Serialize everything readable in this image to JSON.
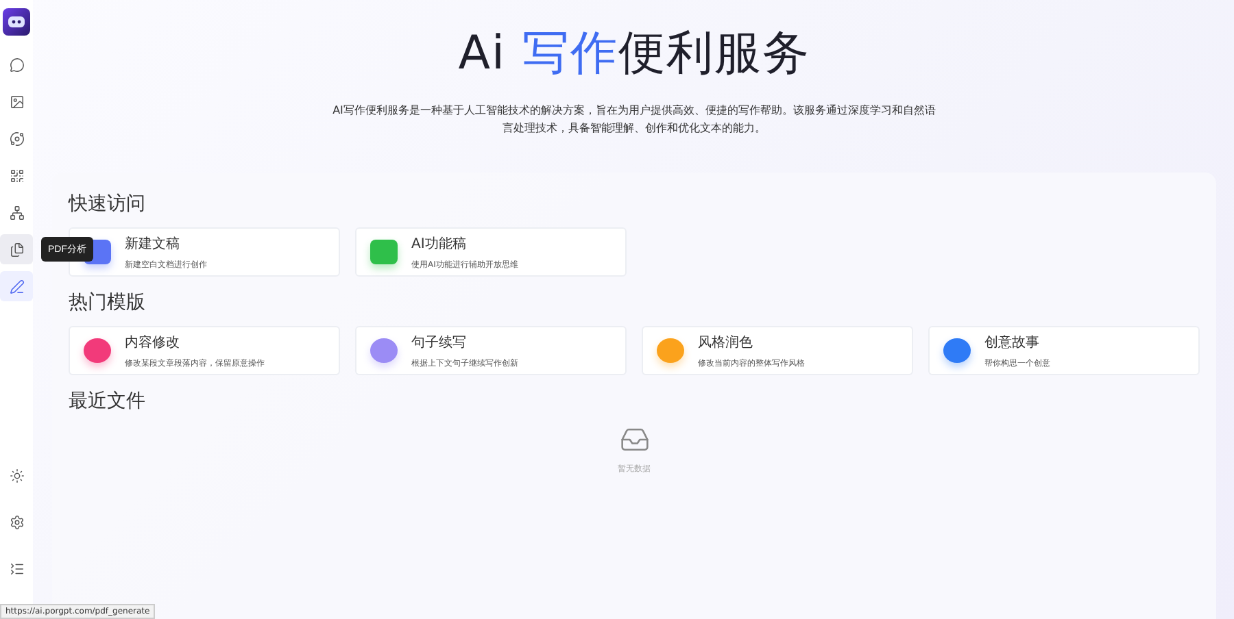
{
  "sidebar": {
    "items": [
      {
        "selected": false,
        "hovered": false
      },
      {
        "selected": false,
        "hovered": false
      },
      {
        "selected": false,
        "hovered": false
      },
      {
        "selected": false,
        "hovered": false
      },
      {
        "selected": false,
        "hovered": false
      },
      {
        "selected": false,
        "hovered": true,
        "tooltip": "PDF分析"
      },
      {
        "selected": true,
        "hovered": false
      }
    ],
    "bottom_items": [
      {
        "selected": false
      },
      {
        "selected": false
      },
      {
        "selected": false
      }
    ]
  },
  "hero": {
    "title_prefix": "Ai ",
    "title_highlight": "写作",
    "title_suffix": "便利服务",
    "description": "AI写作便利服务是一种基于人工智能技术的解决方案，旨在为用户提供高效、便捷的写作帮助。该服务通过深度学习和自然语言处理技术，具备智能理解、创作和优化文本的能力。"
  },
  "sections": [
    {
      "title": "快速访问",
      "cards": [
        {
          "title": "新建文稿",
          "subtitle": "新建空白文档进行创作",
          "color": "#5b74f5"
        },
        {
          "title": "AI功能稿",
          "subtitle": "使用AI功能进行辅助开放思维",
          "color": "#2fbf4a"
        }
      ]
    },
    {
      "title": "热门模版",
      "cards": [
        {
          "title": "内容修改",
          "subtitle": "修改某段文章段落内容，保留原意操作",
          "color": "#f23a7a"
        },
        {
          "title": "句子续写",
          "subtitle": "根据上下文句子继续写作创新",
          "color": "#9b8cf5"
        },
        {
          "title": "风格润色",
          "subtitle": "修改当前内容的整体写作风格",
          "color": "#fba21c"
        },
        {
          "title": "创意故事",
          "subtitle": "帮你构思一个创意",
          "color": "#2f7bf6"
        }
      ]
    }
  ],
  "recent": {
    "title": "最近文件",
    "empty_text": "暂无数据"
  },
  "status_url": "https://ai.porgpt.com/pdf_generate"
}
